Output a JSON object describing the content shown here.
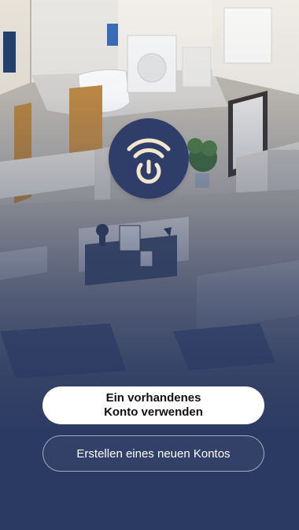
{
  "app": {
    "logo_icon": "wifi-power-icon",
    "accent_color": "#2f3e68",
    "logo_mark_color": "#f3e6cf"
  },
  "actions": {
    "login_line1": "Ein vorhandenes",
    "login_line2": "Konto verwenden",
    "register_label": "Erstellen eines neuen Kontos"
  }
}
